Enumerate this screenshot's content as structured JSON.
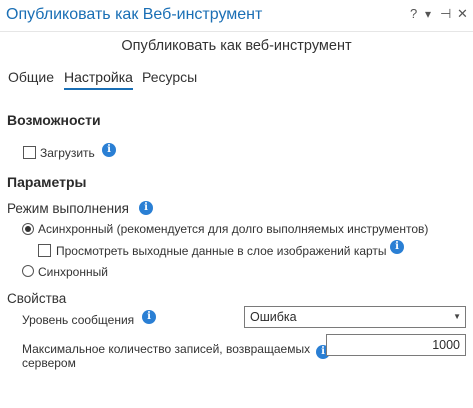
{
  "window": {
    "title": "Опубликовать как Веб-инструмент",
    "help_icon_glyph": "?",
    "menu_icon_glyph": "▾",
    "pin_icon_glyph": "⊣",
    "close_icon_glyph": "✕"
  },
  "pane": {
    "subtitle": "Опубликовать как веб-инструмент"
  },
  "tabs": [
    {
      "label": "Общие"
    },
    {
      "label": "Настройка"
    },
    {
      "label": "Ресурсы"
    }
  ],
  "capabilities": {
    "header": "Возможности",
    "upload_label": "Загрузить",
    "upload_checked": false
  },
  "parameters": {
    "header": "Параметры",
    "execution_mode_label": "Режим выполнения",
    "async_label": "Асинхронный (рекомендуется для долго выполняемых инструментов)",
    "async_selected": true,
    "view_output_label": "Просмотреть выходные данные в слое изображений карты",
    "view_output_checked": false,
    "sync_label": "Синхронный",
    "sync_selected": false
  },
  "properties": {
    "header": "Свойства",
    "message_level_label": "Уровень сообщения",
    "message_level_value": "Ошибка",
    "max_records_label_line1": "Максимальное количество записей, возвращаемых",
    "max_records_label_line2": "сервером",
    "max_records_value": "1000"
  },
  "icons": {
    "info_icon_glyph": "i",
    "dropdown_arrow_glyph": "▼"
  },
  "colors": {
    "accent": "#1a6fb5",
    "info_icon": "#2a7fd4"
  }
}
